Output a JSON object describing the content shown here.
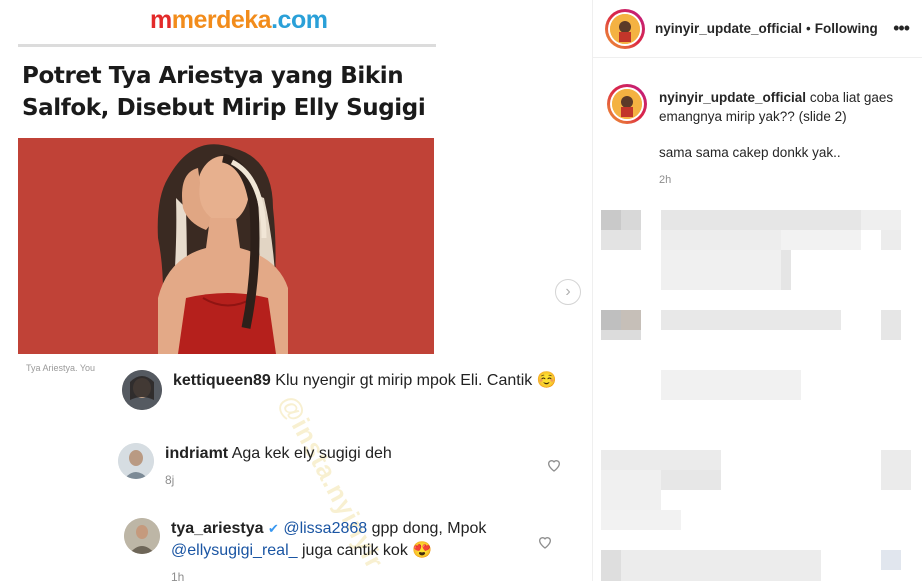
{
  "media": {
    "logo": {
      "part1": "m",
      "part2": "merdeka",
      "part3": ".com"
    },
    "headline": "Potret Tya Ariestya yang Bikin Salfok, Disebut Mirip Elly Sugigi",
    "caption": "Tya Ariestya. You",
    "watermark": "@insta.nyinyir",
    "comments": [
      {
        "username": "kettiqueen89",
        "text": "Klu nyengir gt mirip mpok Eli. Cantik ☺️",
        "time": ""
      },
      {
        "username": "indriamt",
        "text": "Aga kek ely sugigi deh",
        "time": "8j"
      },
      {
        "username": "tya_ariestya",
        "verified": "✔",
        "mention1": "@lissa2868",
        "text1": "gpp dong, Mpok",
        "mention2": "@ellysugigi_real_",
        "text2": "juga cantik kok 😍",
        "time": "1h"
      }
    ],
    "next_icon": "›"
  },
  "sidebar": {
    "header": {
      "username": "nyinyir_update_official",
      "separator": "•",
      "follow_status": "Following",
      "more_icon": "•••"
    },
    "post": {
      "username": "nyinyir_update_official",
      "caption_line": "coba liat gaes emangnya mirip yak?? (slide 2)",
      "second_line": "sama sama cakep donkk yak..",
      "age": "2h"
    }
  },
  "colors": {
    "accent_ring": "#dc2743",
    "logo_red": "#e32a2a",
    "logo_orange": "#f28c1b",
    "logo_blue": "#2aa0d8",
    "photo_bg": "#c8483b"
  }
}
